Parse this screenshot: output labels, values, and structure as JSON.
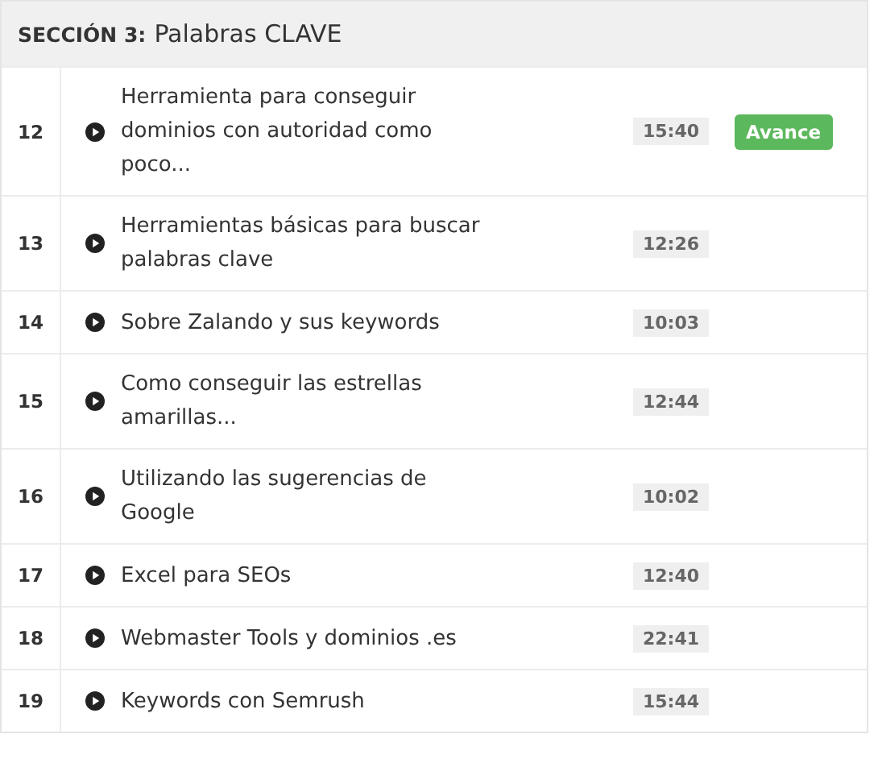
{
  "section": {
    "label": "SECCIÓN 3:",
    "title": "Palabras CLAVE"
  },
  "lessons": [
    {
      "number": "12",
      "title": "Herramienta para conseguir dominios con autoridad como poco...",
      "duration": "15:40",
      "preview": "Avance"
    },
    {
      "number": "13",
      "title": "Herramientas básicas para buscar palabras clave",
      "duration": "12:26"
    },
    {
      "number": "14",
      "title": "Sobre Zalando y sus keywords",
      "duration": "10:03"
    },
    {
      "number": "15",
      "title": "Como conseguir las estrellas amarillas...",
      "duration": "12:44"
    },
    {
      "number": "16",
      "title": "Utilizando las sugerencias de Google",
      "duration": "10:02"
    },
    {
      "number": "17",
      "title": "Excel para SEOs",
      "duration": "12:40"
    },
    {
      "number": "18",
      "title": "Webmaster Tools y dominios .es",
      "duration": "22:41"
    },
    {
      "number": "19",
      "title": "Keywords con Semrush",
      "duration": "15:44"
    }
  ]
}
